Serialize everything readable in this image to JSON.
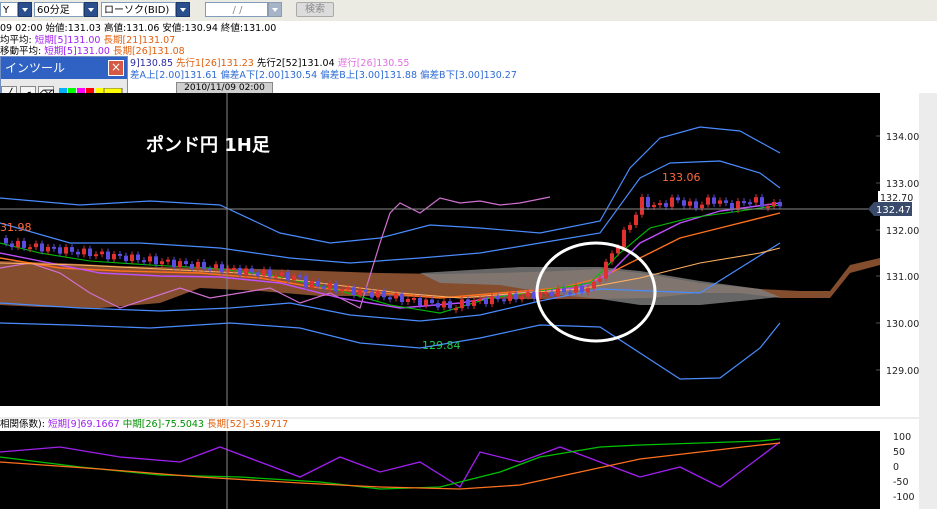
{
  "toolbar": {
    "symbol_text": "Y",
    "timeframe": "60分足",
    "chart_type": "ローソク(BID)",
    "date_input": "/  /",
    "search_label": "検索"
  },
  "info": {
    "ohlc": "09 02:00  始値:131.03  高値:131.06  安値:130.94  終値:131.00",
    "ma_prefix": "均平均:",
    "ma_short": "短期[5]131.00",
    "ma_long": "長期[21]131.07",
    "ma2_prefix": "移動平均:",
    "ma2_short": "短期[5]131.00",
    "ma2_long": "長期[26]131.08",
    "ichimoku_base": "9]130.85",
    "ichimoku_span1": "先行1[26]131.23",
    "ichimoku_span2": "先行2[52]131.04",
    "ichimoku_lag": "遅行[26]130.55",
    "bb_a_up": "差A上[2.00]131.61",
    "bb_a_dn": "偏差A下[2.00]130.54",
    "bb_b_up": "偏差B上[3.00]131.88",
    "bb_b_dn": "偏差B下[3.00]130.27"
  },
  "palette": {
    "title": "インツール",
    "close": "×",
    "swatch_colors": [
      "#00b0ff",
      "#00ff00",
      "#ff00ff",
      "#ff0000",
      "#ffff00",
      "#0000ff",
      "#00ffff",
      "#ff8000",
      "#800080",
      "#808080"
    ],
    "big_swatch_color": "#ffff00"
  },
  "chart": {
    "cursor_datetime": "2010/11/09 02:00",
    "title": "ポンド円 1H足",
    "price_ticks": [
      "134.00",
      "133.00",
      "132.00",
      "131.00",
      "130.00",
      "129.00"
    ],
    "current_price": "132.47",
    "ask_price": "132.70",
    "high_label": "133.06",
    "low_label": "129.84",
    "left_label": "31.98",
    "colors": {
      "background": "#000000",
      "candle_up": "#e03030",
      "candle_down": "#5a4de0",
      "bb_line": "#4a8cff",
      "ichimoku_cloud": "#9a5a36",
      "lag_line": "#d070d0",
      "ma_short": "#c050ff",
      "ma_long": "#ff7020"
    }
  },
  "oscillator": {
    "label": "相関係数):",
    "short": "短期[9]69.1667",
    "mid": "中期[26]-75.5043",
    "long": "長期[52]-35.9717",
    "ticks": [
      "100",
      "50",
      "0",
      "-50",
      "-100"
    ],
    "colors": {
      "short": "#a020f0",
      "mid": "#00c000",
      "long": "#ff7020"
    }
  }
}
